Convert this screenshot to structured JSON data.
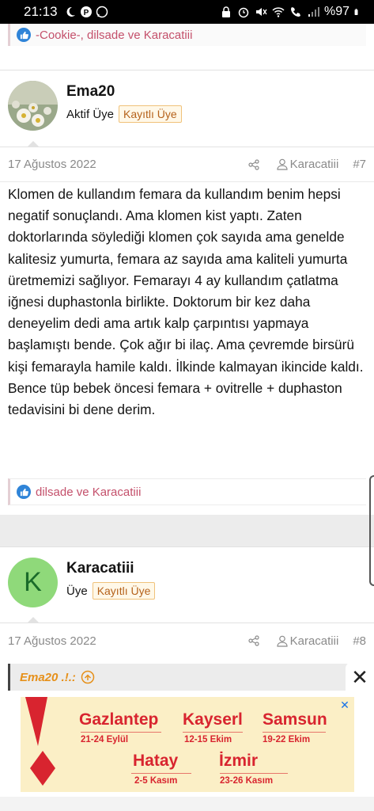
{
  "status_bar": {
    "time": "21:13",
    "battery": "%97"
  },
  "reactions_top": {
    "text": "-Cookie-, dilsade ve Karacatiii"
  },
  "post7": {
    "username": "Ema20",
    "user_title": "Aktif Üye",
    "badge": "Kayıtlı Üye",
    "date": "17 Ağustos 2022",
    "author": "Karacatiii",
    "post_number": "#7",
    "body": "Klomen de kullandım femara da kullandım benim hepsi negatif sonuçlandı. Ama klomen kist yaptı. Zaten doktorlarında söylediği klomen çok sayıda ama genelde kalitesiz yumurta, femara az sayıda ama kaliteli yumurta üretmemizi sağlıyor. Femarayı 4 ay kullandım çatlatma iğnesi duphastonla birlikte. Doktorum bir kez daha deneyelim dedi ama artık kalp çarpıntısı yapmaya başlamıştı bende. Çok ağır bi ilaç. Ama çevremde birsürü kişi femarayla hamile kaldı. İlkinde kalmayan ikincide kaldı. Bence tüp bebek öncesi femara + ovitrelle + duphaston tedavisini bi dene derim.",
    "reactions": "dilsade ve Karacatiii"
  },
  "post8": {
    "avatar_letter": "K",
    "username": "Karacatiii",
    "user_title": "Üye",
    "badge": "Kayıtlı Üye",
    "date": "17 Ağustos 2022",
    "author": "Karacatiii",
    "post_number": "#8",
    "quote_author": "Ema20 .!.:"
  },
  "ad": {
    "close_glyph": "✕",
    "cities": [
      {
        "name": "Gazlantep",
        "dates": "21-24 Eylül"
      },
      {
        "name": "Kayserl",
        "dates": "12-15 Ekim"
      },
      {
        "name": "Samsun",
        "dates": "19-22 Ekim"
      },
      {
        "name": "Hatay",
        "dates": "2-5 Kasım"
      },
      {
        "name": "İzmir",
        "dates": "23-26 Kasım"
      }
    ]
  },
  "colors": {
    "reaction_text": "#c4506b",
    "badge_text": "#b5621b",
    "avatar_green": "#8fd97a",
    "quote_author": "#e6901a",
    "ad_red": "#d8242f"
  }
}
